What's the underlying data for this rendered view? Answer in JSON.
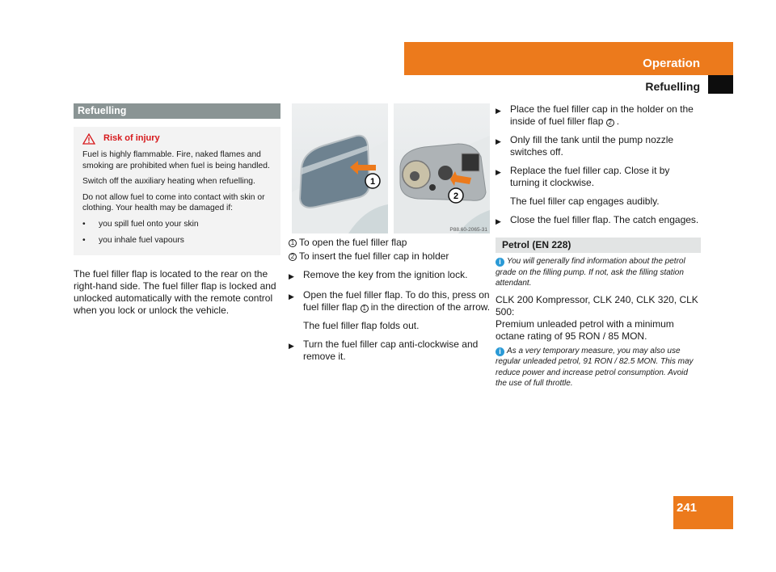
{
  "header": {
    "section": "Operation",
    "subsection": "Refuelling",
    "accent_color": "#ec7a1c"
  },
  "page_number": "241",
  "left_column": {
    "heading": "Refuelling",
    "warning": {
      "icon": "warning-triangle-icon",
      "title": "Risk of injury",
      "paragraphs": [
        "Fuel is highly flammable. Fire, naked flames and smoking are prohibited when fuel is being handled.",
        "Switch off the auxiliary heating when refuelling.",
        "Do not allow fuel to come into contact with skin or clothing. Your health may be damaged if:"
      ],
      "bullets": [
        "you spill fuel onto your skin",
        "you inhale fuel vapours"
      ]
    },
    "body": "The fuel filler flap is located to the rear on the right-hand side. The fuel filler flap is locked and unlocked automatically with the remote control when you lock or unlock the vehicle."
  },
  "middle_column": {
    "figure": {
      "callout_1": "1",
      "callout_2": "2",
      "code": "P88.60-2065-31"
    },
    "legend": [
      {
        "num": "1",
        "text": "To open the fuel filler flap"
      },
      {
        "num": "2",
        "text": "To insert the fuel filler cap in holder"
      }
    ],
    "steps": [
      {
        "text": "Remove the key from the ignition lock."
      },
      {
        "text_before": "Open the fuel filler flap. To do this, press on fuel filler flap",
        "ref": "1",
        "text_after": "in the direction of the arrow.",
        "note": "The fuel filler flap folds out."
      },
      {
        "text": "Turn the fuel filler cap anti-clockwise and remove it."
      }
    ]
  },
  "right_column": {
    "steps": [
      {
        "text_before": "Place the fuel filler cap in the holder on the inside of fuel filler flap",
        "ref": "2",
        "text_after": "."
      },
      {
        "text": "Only fill the tank until the pump nozzle switches off."
      },
      {
        "text": "Replace the fuel filler cap. Close it by turning it clockwise.",
        "note": "The fuel filler cap engages audibly."
      },
      {
        "text": "Close the fuel filler flap. The catch engages."
      }
    ],
    "petrol": {
      "heading": "Petrol (EN 228)",
      "info1": "You will generally find information about the petrol grade on the filling pump. If not, ask the filling station attendant.",
      "models": "CLK 200 Kompressor, CLK 240, CLK 320, CLK 500:",
      "requirement": "Premium unleaded petrol with a minimum octane rating of 95 RON / 85 MON.",
      "info2": "As a very temporary measure, you may also use regular unleaded petrol, 91 RON / 82.5 MON. This may reduce power and increase petrol consumption. Avoid the use of full throttle."
    }
  }
}
